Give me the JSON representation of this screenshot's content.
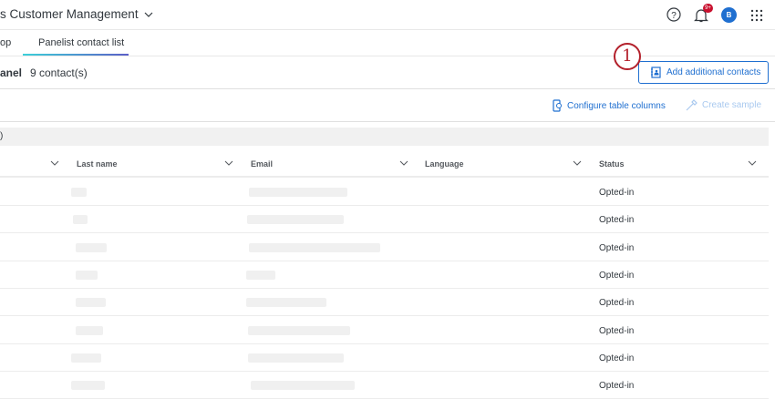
{
  "header": {
    "title": "s Customer Management",
    "notification_count": "9+",
    "avatar_initial": "B"
  },
  "tabs": [
    {
      "label": "op"
    },
    {
      "label": "Panelist contact list",
      "active": true
    }
  ],
  "panel": {
    "name": "anel",
    "count": "9 contact(s)"
  },
  "annotation": {
    "step": "1"
  },
  "buttons": {
    "add_contacts": "Add additional contacts",
    "configure_columns": "Configure table columns",
    "create_sample": "Create sample"
  },
  "band_label": ")",
  "columns": [
    "Last name",
    "Email",
    "Language",
    "Status"
  ],
  "rows": [
    {
      "status": "Opted-in"
    },
    {
      "status": "Opted-in"
    },
    {
      "status": "Opted-in"
    },
    {
      "status": "Opted-in"
    },
    {
      "status": "Opted-in"
    },
    {
      "status": "Opted-in"
    },
    {
      "status": "Opted-in"
    },
    {
      "status": "Opted-in"
    }
  ],
  "colors": {
    "accent": "#1f6fd0",
    "annotation": "#b3202b"
  }
}
